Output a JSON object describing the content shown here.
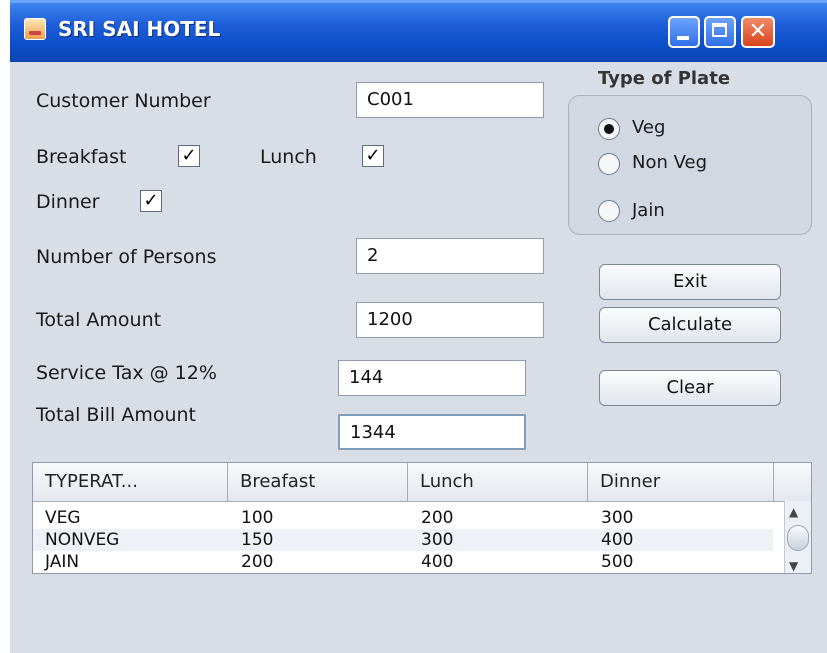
{
  "window": {
    "title": "SRI SAI HOTEL"
  },
  "form": {
    "customer_number_label": "Customer Number",
    "customer_number_value": "C001",
    "breakfast_label": "Breakfast",
    "lunch_label": "Lunch",
    "dinner_label": "Dinner",
    "breakfast_checked": true,
    "lunch_checked": true,
    "dinner_checked": true,
    "check_glyph": "✓",
    "persons_label": "Number of Persons",
    "persons_value": "2",
    "total_amount_label": "Total Amount",
    "total_amount_value": "1200",
    "service_tax_label": "Service Tax @ 12%",
    "service_tax_value": "144",
    "total_bill_label": "Total Bill Amount",
    "total_bill_value": "1344"
  },
  "plate": {
    "title": "Type of Plate",
    "options": [
      "Veg",
      "Non Veg",
      "Jain"
    ],
    "selected": "Veg"
  },
  "buttons": {
    "exit": "Exit",
    "calculate": "Calculate",
    "clear": "Clear"
  },
  "table": {
    "headers": [
      "TYPERAT...",
      "Breafast",
      "Lunch",
      "Dinner"
    ],
    "rows": [
      [
        "VEG",
        "100",
        "200",
        "300"
      ],
      [
        "NONVEG",
        "150",
        "300",
        "400"
      ],
      [
        "JAIN",
        "200",
        "400",
        "500"
      ]
    ]
  },
  "colors": {
    "titlebar": "#0a4dc8",
    "window_bg": "#d8dde6"
  },
  "icons": {
    "close": "✕",
    "scroll_up": "▲",
    "scroll_down": "▼"
  }
}
